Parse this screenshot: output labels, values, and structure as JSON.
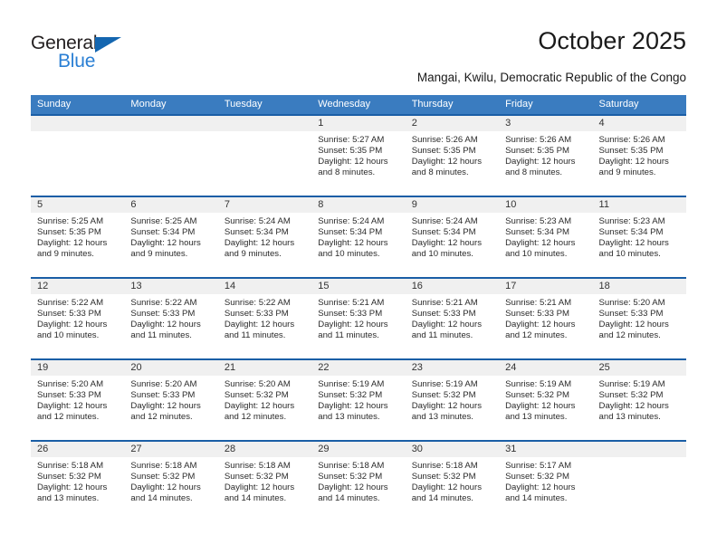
{
  "brand": {
    "name_top": "General",
    "name_bottom": "Blue",
    "triangle_color": "#1466b0",
    "blue_text_color": "#2a7fd4"
  },
  "header": {
    "title": "October 2025",
    "subtitle": "Mangai, Kwilu, Democratic Republic of the Congo"
  },
  "colors": {
    "weekday_header_bg": "#3a7cc0",
    "weekday_header_text": "#ffffff",
    "row_border": "#1a5ea6",
    "daynum_bg": "#f0f0f0"
  },
  "calendar": {
    "weekdays": [
      "Sunday",
      "Monday",
      "Tuesday",
      "Wednesday",
      "Thursday",
      "Friday",
      "Saturday"
    ],
    "weeks": [
      [
        {
          "day": "",
          "sunrise": "",
          "sunset": "",
          "daylight_line1": "",
          "daylight_line2": ""
        },
        {
          "day": "",
          "sunrise": "",
          "sunset": "",
          "daylight_line1": "",
          "daylight_line2": ""
        },
        {
          "day": "",
          "sunrise": "",
          "sunset": "",
          "daylight_line1": "",
          "daylight_line2": ""
        },
        {
          "day": "1",
          "sunrise": "Sunrise: 5:27 AM",
          "sunset": "Sunset: 5:35 PM",
          "daylight_line1": "Daylight: 12 hours",
          "daylight_line2": "and 8 minutes."
        },
        {
          "day": "2",
          "sunrise": "Sunrise: 5:26 AM",
          "sunset": "Sunset: 5:35 PM",
          "daylight_line1": "Daylight: 12 hours",
          "daylight_line2": "and 8 minutes."
        },
        {
          "day": "3",
          "sunrise": "Sunrise: 5:26 AM",
          "sunset": "Sunset: 5:35 PM",
          "daylight_line1": "Daylight: 12 hours",
          "daylight_line2": "and 8 minutes."
        },
        {
          "day": "4",
          "sunrise": "Sunrise: 5:26 AM",
          "sunset": "Sunset: 5:35 PM",
          "daylight_line1": "Daylight: 12 hours",
          "daylight_line2": "and 9 minutes."
        }
      ],
      [
        {
          "day": "5",
          "sunrise": "Sunrise: 5:25 AM",
          "sunset": "Sunset: 5:35 PM",
          "daylight_line1": "Daylight: 12 hours",
          "daylight_line2": "and 9 minutes."
        },
        {
          "day": "6",
          "sunrise": "Sunrise: 5:25 AM",
          "sunset": "Sunset: 5:34 PM",
          "daylight_line1": "Daylight: 12 hours",
          "daylight_line2": "and 9 minutes."
        },
        {
          "day": "7",
          "sunrise": "Sunrise: 5:24 AM",
          "sunset": "Sunset: 5:34 PM",
          "daylight_line1": "Daylight: 12 hours",
          "daylight_line2": "and 9 minutes."
        },
        {
          "day": "8",
          "sunrise": "Sunrise: 5:24 AM",
          "sunset": "Sunset: 5:34 PM",
          "daylight_line1": "Daylight: 12 hours",
          "daylight_line2": "and 10 minutes."
        },
        {
          "day": "9",
          "sunrise": "Sunrise: 5:24 AM",
          "sunset": "Sunset: 5:34 PM",
          "daylight_line1": "Daylight: 12 hours",
          "daylight_line2": "and 10 minutes."
        },
        {
          "day": "10",
          "sunrise": "Sunrise: 5:23 AM",
          "sunset": "Sunset: 5:34 PM",
          "daylight_line1": "Daylight: 12 hours",
          "daylight_line2": "and 10 minutes."
        },
        {
          "day": "11",
          "sunrise": "Sunrise: 5:23 AM",
          "sunset": "Sunset: 5:34 PM",
          "daylight_line1": "Daylight: 12 hours",
          "daylight_line2": "and 10 minutes."
        }
      ],
      [
        {
          "day": "12",
          "sunrise": "Sunrise: 5:22 AM",
          "sunset": "Sunset: 5:33 PM",
          "daylight_line1": "Daylight: 12 hours",
          "daylight_line2": "and 10 minutes."
        },
        {
          "day": "13",
          "sunrise": "Sunrise: 5:22 AM",
          "sunset": "Sunset: 5:33 PM",
          "daylight_line1": "Daylight: 12 hours",
          "daylight_line2": "and 11 minutes."
        },
        {
          "day": "14",
          "sunrise": "Sunrise: 5:22 AM",
          "sunset": "Sunset: 5:33 PM",
          "daylight_line1": "Daylight: 12 hours",
          "daylight_line2": "and 11 minutes."
        },
        {
          "day": "15",
          "sunrise": "Sunrise: 5:21 AM",
          "sunset": "Sunset: 5:33 PM",
          "daylight_line1": "Daylight: 12 hours",
          "daylight_line2": "and 11 minutes."
        },
        {
          "day": "16",
          "sunrise": "Sunrise: 5:21 AM",
          "sunset": "Sunset: 5:33 PM",
          "daylight_line1": "Daylight: 12 hours",
          "daylight_line2": "and 11 minutes."
        },
        {
          "day": "17",
          "sunrise": "Sunrise: 5:21 AM",
          "sunset": "Sunset: 5:33 PM",
          "daylight_line1": "Daylight: 12 hours",
          "daylight_line2": "and 12 minutes."
        },
        {
          "day": "18",
          "sunrise": "Sunrise: 5:20 AM",
          "sunset": "Sunset: 5:33 PM",
          "daylight_line1": "Daylight: 12 hours",
          "daylight_line2": "and 12 minutes."
        }
      ],
      [
        {
          "day": "19",
          "sunrise": "Sunrise: 5:20 AM",
          "sunset": "Sunset: 5:33 PM",
          "daylight_line1": "Daylight: 12 hours",
          "daylight_line2": "and 12 minutes."
        },
        {
          "day": "20",
          "sunrise": "Sunrise: 5:20 AM",
          "sunset": "Sunset: 5:33 PM",
          "daylight_line1": "Daylight: 12 hours",
          "daylight_line2": "and 12 minutes."
        },
        {
          "day": "21",
          "sunrise": "Sunrise: 5:20 AM",
          "sunset": "Sunset: 5:32 PM",
          "daylight_line1": "Daylight: 12 hours",
          "daylight_line2": "and 12 minutes."
        },
        {
          "day": "22",
          "sunrise": "Sunrise: 5:19 AM",
          "sunset": "Sunset: 5:32 PM",
          "daylight_line1": "Daylight: 12 hours",
          "daylight_line2": "and 13 minutes."
        },
        {
          "day": "23",
          "sunrise": "Sunrise: 5:19 AM",
          "sunset": "Sunset: 5:32 PM",
          "daylight_line1": "Daylight: 12 hours",
          "daylight_line2": "and 13 minutes."
        },
        {
          "day": "24",
          "sunrise": "Sunrise: 5:19 AM",
          "sunset": "Sunset: 5:32 PM",
          "daylight_line1": "Daylight: 12 hours",
          "daylight_line2": "and 13 minutes."
        },
        {
          "day": "25",
          "sunrise": "Sunrise: 5:19 AM",
          "sunset": "Sunset: 5:32 PM",
          "daylight_line1": "Daylight: 12 hours",
          "daylight_line2": "and 13 minutes."
        }
      ],
      [
        {
          "day": "26",
          "sunrise": "Sunrise: 5:18 AM",
          "sunset": "Sunset: 5:32 PM",
          "daylight_line1": "Daylight: 12 hours",
          "daylight_line2": "and 13 minutes."
        },
        {
          "day": "27",
          "sunrise": "Sunrise: 5:18 AM",
          "sunset": "Sunset: 5:32 PM",
          "daylight_line1": "Daylight: 12 hours",
          "daylight_line2": "and 14 minutes."
        },
        {
          "day": "28",
          "sunrise": "Sunrise: 5:18 AM",
          "sunset": "Sunset: 5:32 PM",
          "daylight_line1": "Daylight: 12 hours",
          "daylight_line2": "and 14 minutes."
        },
        {
          "day": "29",
          "sunrise": "Sunrise: 5:18 AM",
          "sunset": "Sunset: 5:32 PM",
          "daylight_line1": "Daylight: 12 hours",
          "daylight_line2": "and 14 minutes."
        },
        {
          "day": "30",
          "sunrise": "Sunrise: 5:18 AM",
          "sunset": "Sunset: 5:32 PM",
          "daylight_line1": "Daylight: 12 hours",
          "daylight_line2": "and 14 minutes."
        },
        {
          "day": "31",
          "sunrise": "Sunrise: 5:17 AM",
          "sunset": "Sunset: 5:32 PM",
          "daylight_line1": "Daylight: 12 hours",
          "daylight_line2": "and 14 minutes."
        },
        {
          "day": "",
          "sunrise": "",
          "sunset": "",
          "daylight_line1": "",
          "daylight_line2": ""
        }
      ]
    ]
  }
}
